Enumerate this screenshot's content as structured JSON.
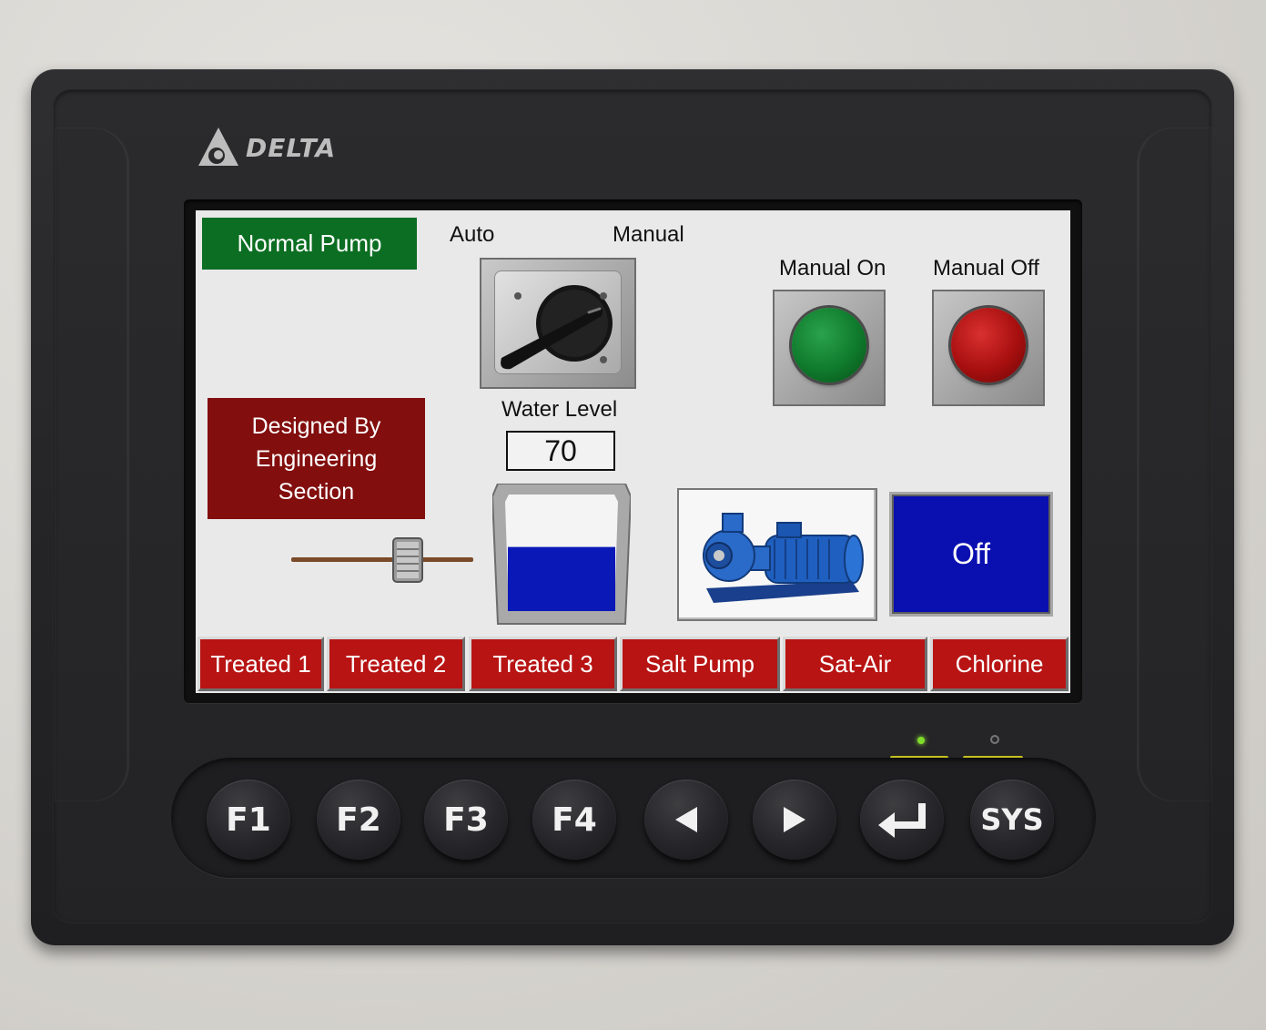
{
  "device": {
    "brand": "DELTA"
  },
  "screen": {
    "normal_pump": "Normal Pump",
    "designed_by": [
      "Designed By",
      "Engineering",
      "Section"
    ],
    "selector": {
      "auto_label": "Auto",
      "manual_label": "Manual"
    },
    "manual_on_label": "Manual On",
    "manual_off_label": "Manual Off",
    "water_level": {
      "label": "Water Level",
      "value": "70",
      "fill_fraction": 0.55
    },
    "pump_status": "Off",
    "nav_tabs": [
      "Treated 1",
      "Treated 2",
      "Treated 3",
      "Salt Pump",
      "Sat-Air",
      "Chlorine"
    ]
  },
  "keys": {
    "f1": "F1",
    "f2": "F2",
    "f3": "F3",
    "f4": "F4",
    "left_icon": "left-arrow-icon",
    "right_icon": "right-arrow-icon",
    "enter_icon": "enter-icon",
    "sys": "SYS"
  },
  "colors": {
    "normal_pump_bg": "#0c6e22",
    "designed_by_bg": "#820e0e",
    "manual_on_green": "#0f7a2c",
    "manual_off_red": "#a80f0f",
    "off_tile_blue": "#0a0fb0",
    "water_blue": "#0a18b8",
    "nav_red": "#b81414",
    "led_green": "#7fdc2a"
  }
}
